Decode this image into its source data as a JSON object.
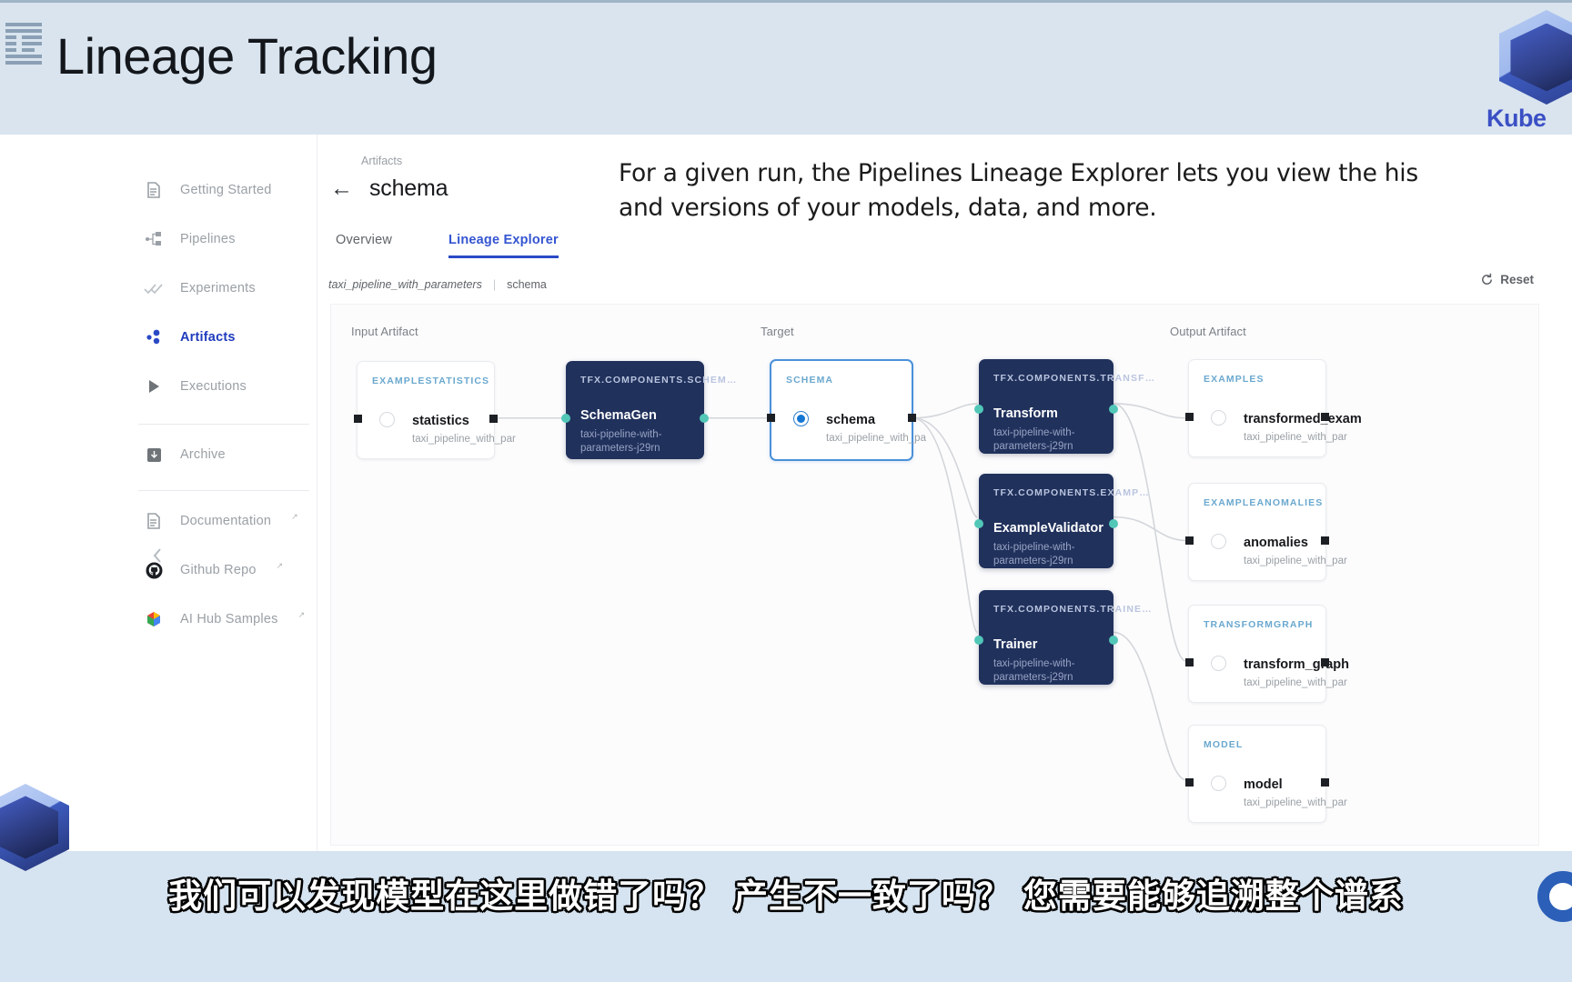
{
  "header": {
    "title": "Lineage Tracking",
    "logo_icon": "ibm-logo-icon",
    "brand_name": "Kubeflow",
    "brand_short": "Kube"
  },
  "overlay": {
    "narration": "For a given run, the Pipelines Lineage Explorer lets you view the his\nand versions of your models, data, and more."
  },
  "sidebar": {
    "collapse_icon": "chevron-left-icon",
    "items": [
      {
        "label": "Getting Started",
        "icon": "document-icon",
        "active": false,
        "external": false
      },
      {
        "label": "Pipelines",
        "icon": "pipeline-icon",
        "active": false,
        "external": false
      },
      {
        "label": "Experiments",
        "icon": "double-check-icon",
        "active": false,
        "external": false
      },
      {
        "label": "Artifacts",
        "icon": "artifacts-dots-icon",
        "active": true,
        "external": false
      },
      {
        "label": "Executions",
        "icon": "play-triangle-icon",
        "active": false,
        "external": false
      },
      {
        "label": "Archive",
        "icon": "archive-box-icon",
        "active": false,
        "external": false
      },
      {
        "label": "Documentation",
        "icon": "document-icon",
        "active": false,
        "external": true
      },
      {
        "label": "Github Repo",
        "icon": "github-icon",
        "active": false,
        "external": true
      },
      {
        "label": "AI Hub Samples",
        "icon": "ai-hub-icon",
        "active": false,
        "external": true
      }
    ],
    "external_glyph": "↗"
  },
  "content": {
    "breadcrumb": "Artifacts",
    "page_title": "schema",
    "back_icon": "arrow-left-icon",
    "tabs": [
      {
        "label": "Overview",
        "active": false
      },
      {
        "label": "Lineage Explorer",
        "active": true
      }
    ],
    "sub_breadcrumb": {
      "pipeline": "taxi_pipeline_with_parameters",
      "separator": "|",
      "artifact": "schema"
    },
    "reset": {
      "label": "Reset",
      "icon": "refresh-icon"
    }
  },
  "graph": {
    "columns": [
      {
        "label": "Input Artifact"
      },
      {
        "label": "Target"
      },
      {
        "label": "Output Artifact"
      }
    ],
    "input_artifacts": [
      {
        "type": "EXAMPLESTATISTICS",
        "title": "statistics",
        "subtitle": "taxi_pipeline_with_par"
      }
    ],
    "left_executions": [
      {
        "type": "TFX.COMPONENTS.SCHEM…",
        "title": "SchemaGen",
        "subtitle": "taxi-pipeline-with-parameters-j29rn"
      }
    ],
    "target": {
      "type": "SCHEMA",
      "title": "schema",
      "subtitle": "taxi_pipeline_with_pa"
    },
    "right_executions": [
      {
        "type": "TFX.COMPONENTS.TRANSF…",
        "title": "Transform",
        "subtitle": "taxi-pipeline-with-parameters-j29rn"
      },
      {
        "type": "TFX.COMPONENTS.EXAMP…",
        "title": "ExampleValidator",
        "subtitle": "taxi-pipeline-with-parameters-j29rn"
      },
      {
        "type": "TFX.COMPONENTS.TRAINE…",
        "title": "Trainer",
        "subtitle": "taxi-pipeline-with-parameters-j29rn"
      }
    ],
    "output_artifacts": [
      {
        "type": "EXAMPLES",
        "title": "transformed_exam",
        "subtitle": "taxi_pipeline_with_par"
      },
      {
        "type": "EXAMPLEANOMALIES",
        "title": "anomalies",
        "subtitle": "taxi_pipeline_with_par"
      },
      {
        "type": "TRANSFORMGRAPH",
        "title": "transform_graph",
        "subtitle": "taxi_pipeline_with_par"
      },
      {
        "type": "MODEL",
        "title": "model",
        "subtitle": "taxi_pipeline_with_par"
      }
    ]
  },
  "caption": {
    "text": "我们可以发现模型在这里做错了吗？ 产生不一致了吗？ 您需要能够追溯整个谱系"
  },
  "colors": {
    "header_bg": "#d9e4ef",
    "accent_blue": "#2a49c6",
    "exec_card": "#20315c",
    "artifact_type": "#6aa8cf",
    "target_border": "#4a90d9",
    "port_teal": "#52c7b8",
    "caption_band": "#d6e3f0"
  }
}
